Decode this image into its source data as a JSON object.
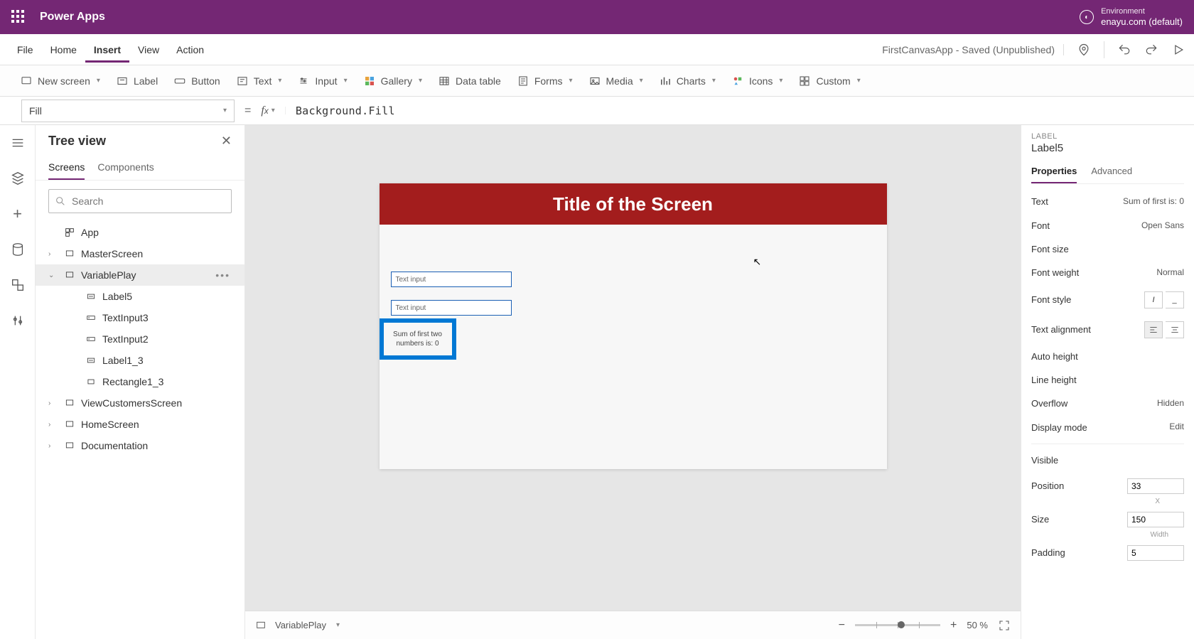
{
  "header": {
    "app_name": "Power Apps",
    "env_label": "Environment",
    "env_name": "enayu.com (default)"
  },
  "menubar": {
    "items": [
      "File",
      "Home",
      "Insert",
      "View",
      "Action"
    ],
    "active": "Insert",
    "saved_text": "FirstCanvasApp - Saved (Unpublished)"
  },
  "ribbon": {
    "new_screen": "New screen",
    "label": "Label",
    "button": "Button",
    "text": "Text",
    "input": "Input",
    "gallery": "Gallery",
    "data_table": "Data table",
    "forms": "Forms",
    "media": "Media",
    "charts": "Charts",
    "icons": "Icons",
    "custom": "Custom"
  },
  "formula_bar": {
    "property": "Fill",
    "expression": "Background.Fill"
  },
  "tree": {
    "title": "Tree view",
    "tabs": {
      "screens": "Screens",
      "components": "Components"
    },
    "search_placeholder": "Search",
    "app": "App",
    "nodes": {
      "master": "MasterScreen",
      "variableplay": "VariablePlay",
      "label5": "Label5",
      "textinput3": "TextInput3",
      "textinput2": "TextInput2",
      "label1_3": "Label1_3",
      "rectangle1_3": "Rectangle1_3",
      "viewcustomers": "ViewCustomersScreen",
      "homescreen": "HomeScreen",
      "documentation": "Documentation"
    }
  },
  "canvas": {
    "title_text": "Title of the Screen",
    "textinput_placeholder": "Text input",
    "selected_label_text": "Sum of first two numbers is: 0",
    "status_screen": "VariablePlay",
    "zoom_pct": "50 %"
  },
  "props": {
    "type": "LABEL",
    "name": "Label5",
    "tabs": {
      "properties": "Properties",
      "advanced": "Advanced"
    },
    "rows": {
      "text_label": "Text",
      "text_value": "Sum of first is: 0",
      "font_label": "Font",
      "font_value": "Open Sans",
      "fontsize_label": "Font size",
      "fontweight_label": "Font weight",
      "fontweight_value": "Normal",
      "fontstyle_label": "Font style",
      "textalign_label": "Text alignment",
      "autoheight_label": "Auto height",
      "lineheight_label": "Line height",
      "overflow_label": "Overflow",
      "overflow_value": "Hidden",
      "displaymode_label": "Display mode",
      "displaymode_value": "Edit",
      "visible_label": "Visible",
      "position_label": "Position",
      "position_x": "33",
      "position_x_sub": "X",
      "size_label": "Size",
      "size_w": "150",
      "size_w_sub": "Width",
      "padding_label": "Padding",
      "padding_v": "5"
    }
  }
}
